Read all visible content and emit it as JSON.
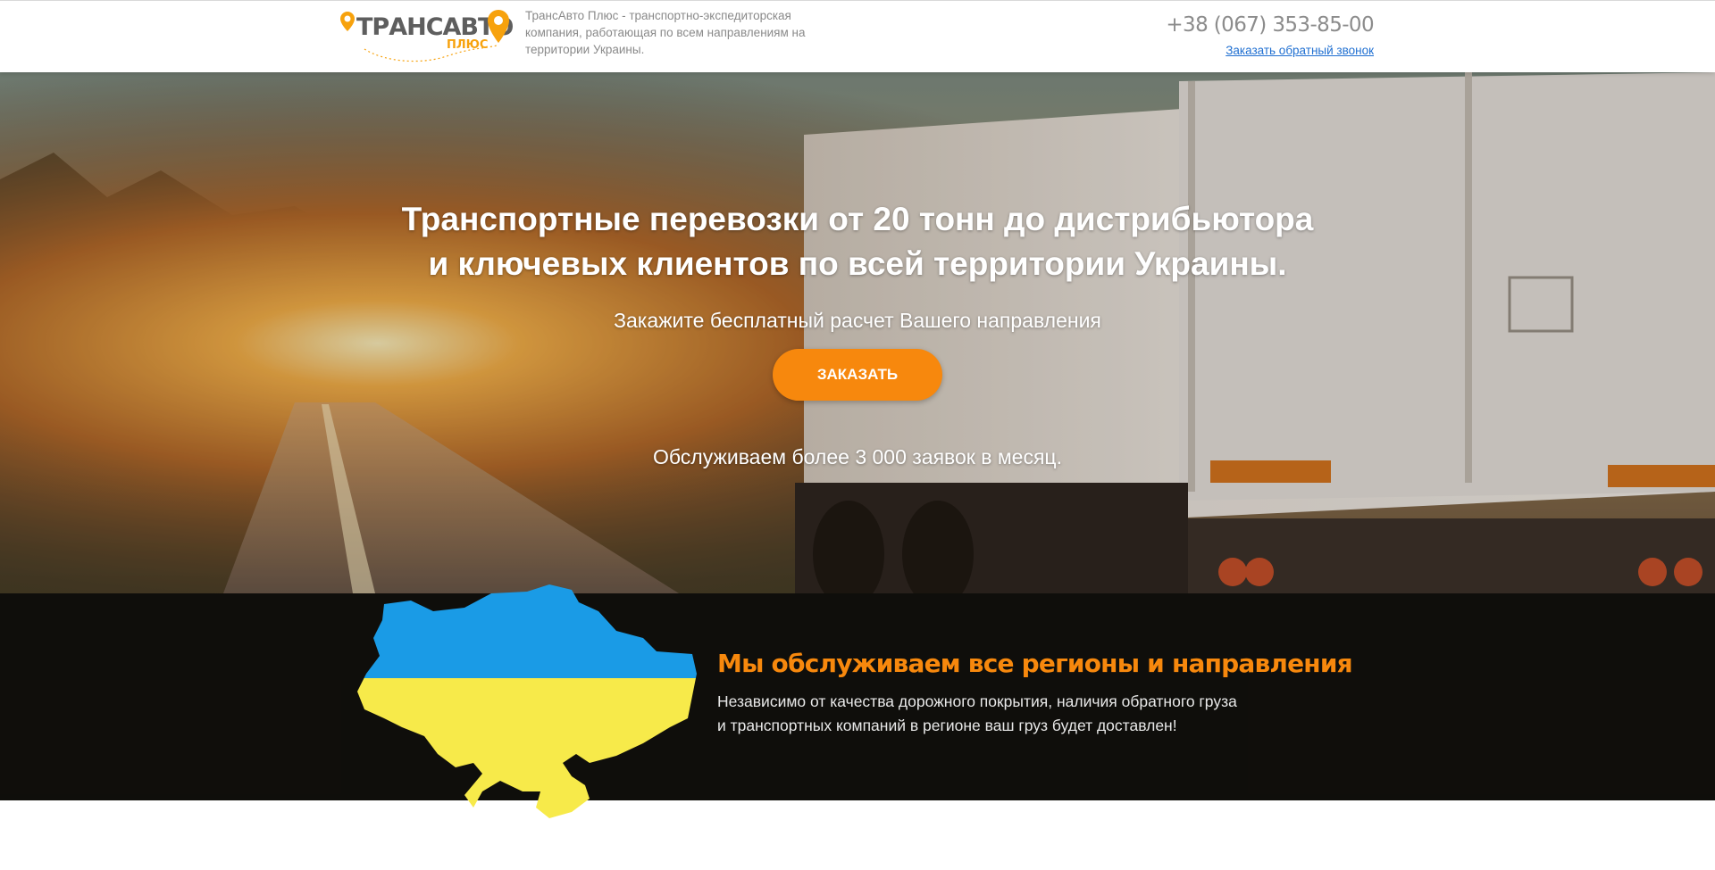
{
  "header": {
    "logo_text": "ТРАНСАВТО",
    "logo_sub": "ПЛЮС",
    "tagline": "ТрансАвто Плюс - транспортно-экспедиторская компания, работающая по всем направлениям на территории Украины.",
    "phone": "+38 (067) 353-85-00",
    "callback_label": "Заказать обратный звонок"
  },
  "hero": {
    "title_line1": "Транспортные перевозки от 20 тонн до дистрибьютора",
    "title_line2": "и ключевых клиентов по всей территории Украины.",
    "subtitle": "Закажите бесплатный расчет Вашего направления",
    "order_button": "ЗАКАЗАТЬ",
    "stat": "Обслуживаем более 3 000 заявок в месяц."
  },
  "regions": {
    "title": "Мы обслуживаем все регионы и направления",
    "text_line1": "Независимо от качества дорожного покрытия, наличия обратного груза",
    "text_line2": "и транспортных компаний в регионе ваш груз будет доставлен!"
  },
  "colors": {
    "accent_orange": "#f7880d",
    "link_blue": "#1f6fd1",
    "flag_blue": "#1a9be6",
    "flag_yellow": "#f7ea4a"
  }
}
